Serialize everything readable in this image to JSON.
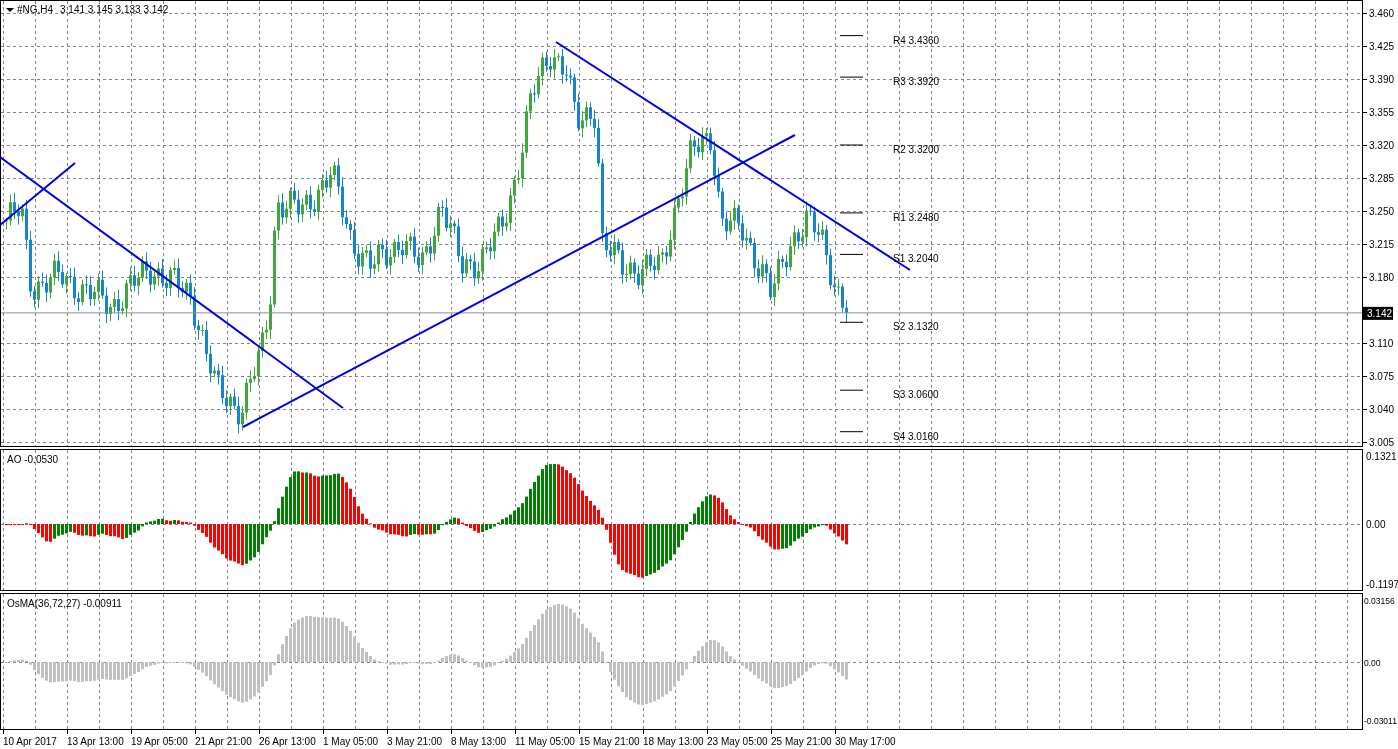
{
  "symbol_header": {
    "symbol": "#NG,H4",
    "ohlc": "3.141 3.145 3.133 3.142"
  },
  "price_chart": {
    "yticks": [
      "3.460",
      "3.425",
      "3.390",
      "3.355",
      "3.320",
      "3.285",
      "3.250",
      "3.215",
      "3.180",
      "3.110",
      "3.075",
      "3.040",
      "3.005"
    ],
    "current_price": "3.142",
    "pivot_levels": [
      {
        "name": "R4",
        "value": "3.4360"
      },
      {
        "name": "R3",
        "value": "3.3920"
      },
      {
        "name": "R2",
        "value": "3.3200"
      },
      {
        "name": "R1",
        "value": "3.2480"
      },
      {
        "name": "S1",
        "value": "3.2040"
      },
      {
        "name": "S2",
        "value": "3.1320"
      },
      {
        "name": "S3",
        "value": "3.0600"
      },
      {
        "name": "S4",
        "value": "3.0160"
      }
    ]
  },
  "ao_indicator": {
    "label": "AO -0.0530",
    "yticks": [
      "0.1321",
      "0.00",
      "-0.1197"
    ]
  },
  "osma_indicator": {
    "label": "OsMA(36,72,27) -0.00911",
    "yticks": [
      "0.03156",
      "0.00",
      "-0.03011"
    ]
  },
  "time_axis": {
    "labels": [
      "10 Apr 2017",
      "13 Apr 13:00",
      "19 Apr 05:00",
      "21 Apr 21:00",
      "26 Apr 13:00",
      "1 May 05:00",
      "3 May 21:00",
      "8 May 13:00",
      "11 May 05:00",
      "15 May 21:00",
      "18 May 13:00",
      "23 May 05:00",
      "25 May 21:00",
      "30 May 17:00"
    ]
  }
}
